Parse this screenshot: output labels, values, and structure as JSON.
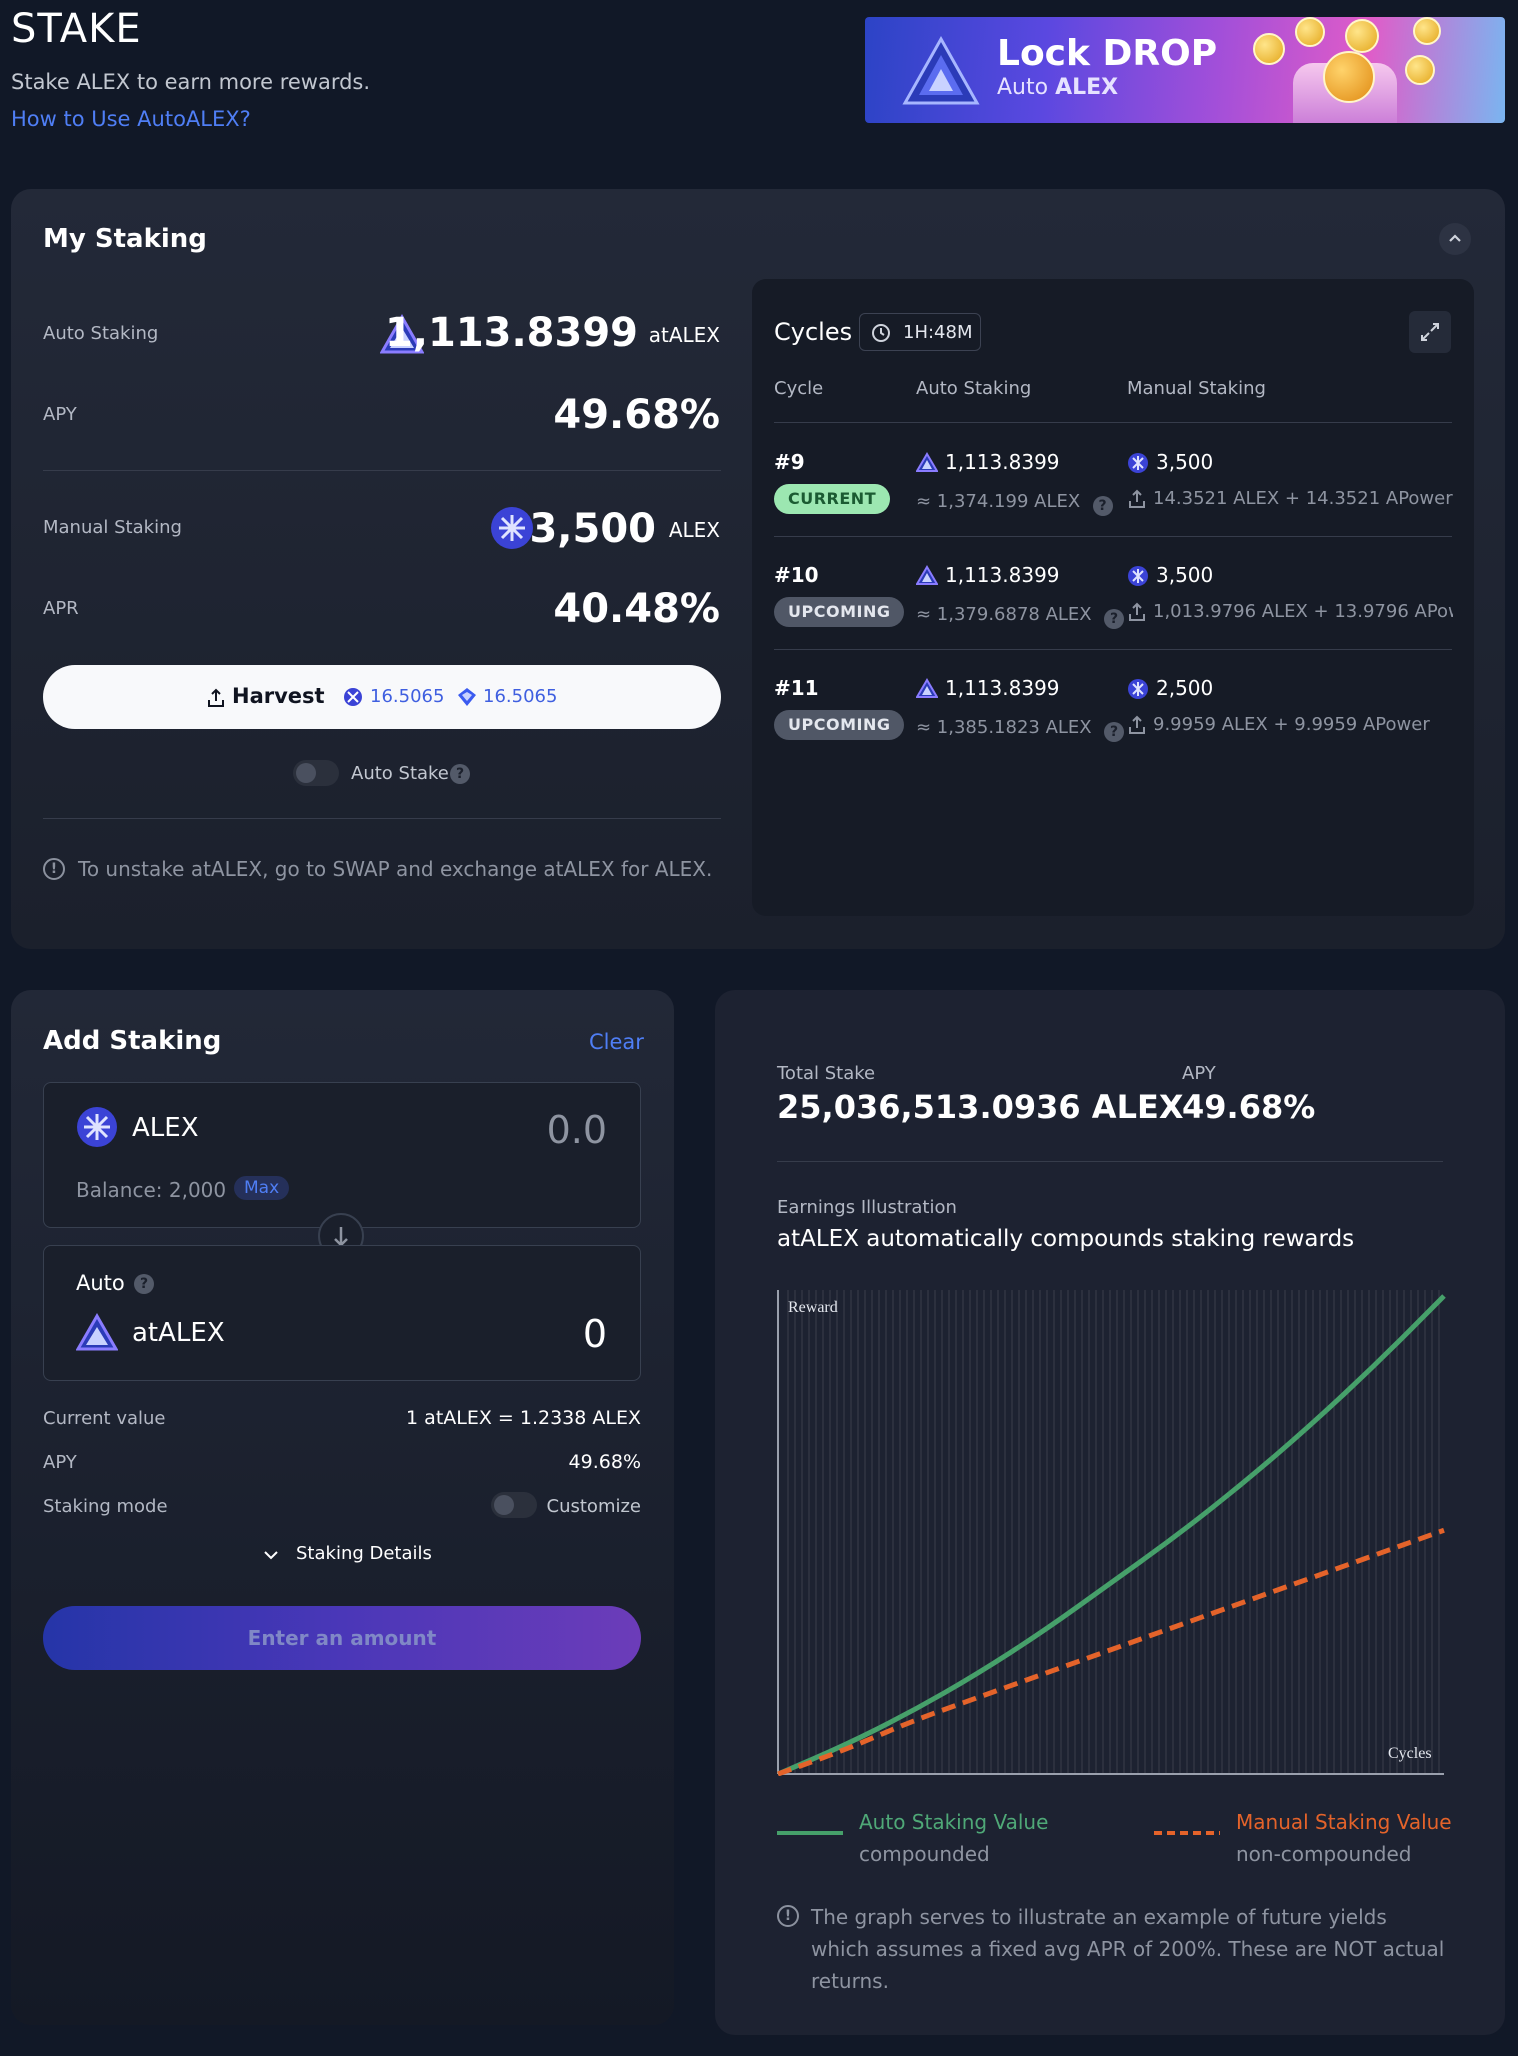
{
  "header": {
    "title": "STAKE",
    "subtitle": "Stake ALEX to earn more rewards.",
    "help_link": "How to Use AutoALEX?"
  },
  "banner": {
    "line1_a": "Lock ",
    "line1_b": "DROP",
    "line2_a": "Auto ",
    "line2_b": "ALEX"
  },
  "my_staking": {
    "title": "My Staking",
    "auto_staking_label": "Auto Staking",
    "auto_staking_value": "1,113.8399",
    "auto_staking_unit": "atALEX",
    "apy_label": "APY",
    "apy_value": "49.68%",
    "manual_staking_label": "Manual Staking",
    "manual_staking_value": "3,500",
    "manual_staking_unit": "ALEX",
    "apr_label": "APR",
    "apr_value": "40.48%",
    "harvest_label": "Harvest",
    "harvest_alex": "16.5065",
    "harvest_apower": "16.5065",
    "auto_stake_label": "Auto Stake",
    "unstake_note": "To unstake atALEX, go to SWAP and exchange atALEX for ALEX."
  },
  "cycles": {
    "title": "Cycles",
    "timer": "1H:48M",
    "headers": [
      "Cycle",
      "Auto Staking",
      "Manual Staking"
    ],
    "rows": [
      {
        "num": "#9",
        "status": "CURRENT",
        "auto": "1,113.8399",
        "auto_sub": "≈ 1,374.199 ALEX",
        "manual": "3,500",
        "manual_sub": "14.3521 ALEX + 14.3521 APower"
      },
      {
        "num": "#10",
        "status": "UPCOMING",
        "auto": "1,113.8399",
        "auto_sub": "≈ 1,379.6878 ALEX",
        "manual": "3,500",
        "manual_sub": "1,013.9796 ALEX + 13.9796 APowe"
      },
      {
        "num": "#11",
        "status": "UPCOMING",
        "auto": "1,113.8399",
        "auto_sub": "≈ 1,385.1823 ALEX",
        "manual": "2,500",
        "manual_sub": "9.9959 ALEX + 9.9959 APower"
      }
    ]
  },
  "add_staking": {
    "title": "Add Staking",
    "clear": "Clear",
    "from_token": "ALEX",
    "from_value": "0.0",
    "balance": "Balance: 2,000",
    "max": "Max",
    "to_label": "Auto",
    "to_token": "atALEX",
    "to_value": "0",
    "current_value_label": "Current value",
    "current_value": "1 atALEX = 1.2338 ALEX",
    "apy_label": "APY",
    "apy_value": "49.68%",
    "mode_label": "Staking mode",
    "mode_value": "Customize",
    "details": "Staking Details",
    "submit": "Enter an amount"
  },
  "stats": {
    "total_stake_label": "Total Stake",
    "total_stake_value": "25,036,513.0936 ALEX",
    "apy_label": "APY",
    "apy_value": "49.68%",
    "earnings_label": "Earnings Illustration",
    "earnings_title": "atALEX automatically compounds staking rewards",
    "legend_auto": "Auto Staking Value",
    "legend_auto_sub": "compounded",
    "legend_manual": "Manual Staking Value",
    "legend_manual_sub": "non-compounded",
    "note": "The graph serves to illustrate an example of future yields which assumes a fixed avg APR of 200%. These are NOT actual returns."
  },
  "chart_data": {
    "type": "line",
    "xlabel": "Cycles",
    "ylabel": "Reward",
    "series": [
      {
        "name": "Auto Staking Value",
        "color": "#46a06a",
        "style": "solid",
        "values": [
          0,
          0.06,
          0.13,
          0.21,
          0.3,
          0.4,
          0.5,
          0.61,
          0.73,
          0.86,
          1.0
        ]
      },
      {
        "name": "Manual Staking Value",
        "color": "#e4632a",
        "style": "dashed",
        "values": [
          0,
          0.05,
          0.11,
          0.16,
          0.21,
          0.26,
          0.31,
          0.36,
          0.41,
          0.46,
          0.51
        ]
      }
    ],
    "grid": true
  },
  "colors": {
    "background": "#111827",
    "link": "#4f7ef5",
    "auto_series": "#46a06a",
    "manual_series": "#e4632a"
  },
  "icons": [
    "alex-token-icon",
    "atalex-token-icon",
    "apower-icon",
    "harvest-icon",
    "timer-icon",
    "expand-icon",
    "chevron-up-icon",
    "chevron-down-icon",
    "info-icon",
    "question-icon",
    "arrow-down-icon"
  ]
}
